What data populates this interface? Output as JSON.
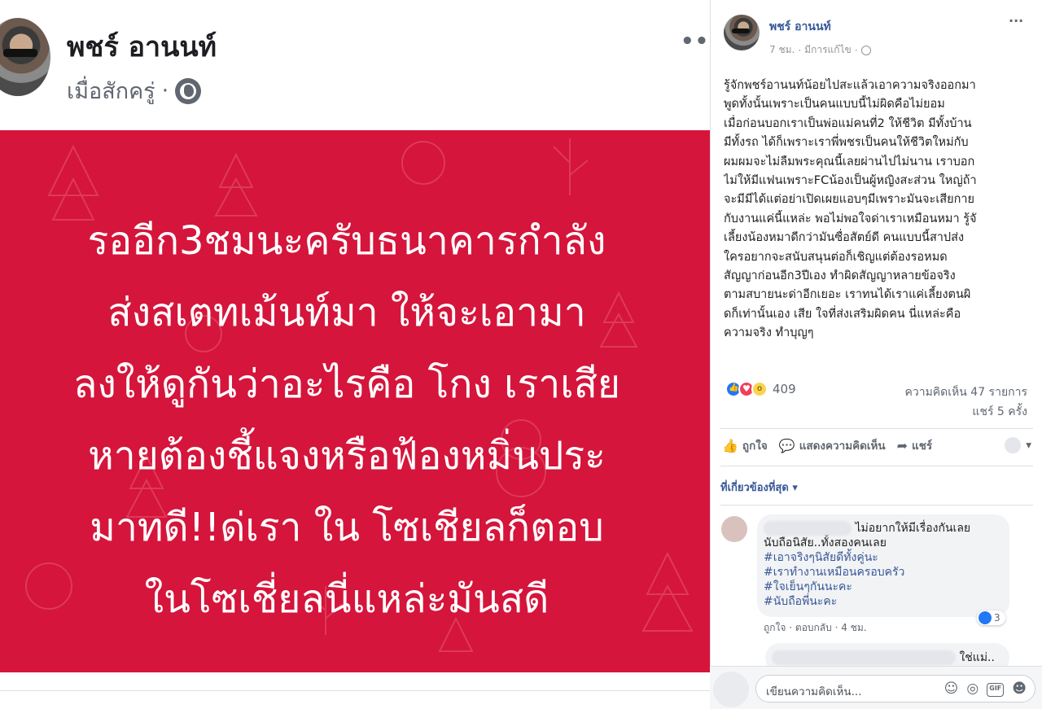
{
  "post": {
    "author": "พชร์ อานนท์",
    "time": "เมื่อสักครู่",
    "separator": "·",
    "more": "•••",
    "image_text": [
      "รออีก3ชมนะครับธนาคารกำลัง",
      "ส่งสเตทเม้นท์มา ให้จะเอามา",
      "ลงให้ดูกันว่าอะไรคือ โกง เราเสีย",
      "หายต้องชี้แจงหรือฟ้องหมิ่นประ",
      "มาทดี!!ด่เรา ใน โซเชียลก็ตอบ",
      "ในโซเชี่ยลนี่แหล่ะมันสดี"
    ],
    "image_bg_color": "#d5153b"
  },
  "side": {
    "author": "พชร์ อานนท์",
    "time": "7 ชม.",
    "edited": "มีการแก้ไข",
    "separator": "·",
    "more": "···",
    "caption": [
      "รู้จักพชร์อานนท์น้อยไปสะแล้วเอาความจริงออกมา",
      "พูดทั้งนั้นเพราะเป็นคนแบบนี้ไม่ผิดคือไม่ยอม",
      "เมื่อก่อนบอกเราเป็นพ่อแม่คนที่2 ให้ชีวิต มีทั้งบ้าน",
      "มีทั้งรถ ได้ก็เพราะเราพี่พชรเป็นคนให้ชีวิตใหม่กับ",
      "ผมผมจะไม่ลืมพระคุณนี้เลยผ่านไปไม่นาน เราบอก",
      "ไม่ให้มีแฟนเพราะFCน้องเป็นผู้หญิงสะส่วน ใหญ่ถ้า",
      "จะมีมีได้แต่อย่าเปิดเผยแอบๆมีเพราะมันจะเสียกาย",
      "กับงานแค่นี้แหล่ะ พอไม่พอใจด่าเราเหมือนหมา รู้จั",
      "เลี้ยงน้องหมาดีกว่ามันซื่อสัตย์ดี คนแบบนี้สาปส่ง",
      "ใครอยากจะสนับสนุนต่อก็เชิญแต่ต้องรอหมด",
      "สัญญาก่อนอีก3ปีเอง ทำผิดสัญญาหลายข้อจริง",
      "ตามสบายนะด่าอีกเยอะ เราทนได้เราแค่เลี้ยงตนผิ",
      "ดก็เท่านั้นเอง เสีย ใจที่ส่งเสริมผิดคน นี่แหล่ะคือ",
      "ความจริง ทำบุญๆ"
    ],
    "reaction_count": "409",
    "comments_count": "ความคิดเห็น 47 รายการ",
    "shares_count": "แชร์ 5 ครั้ง",
    "actions": {
      "like": "ถูกใจ",
      "comment": "แสดงความคิดเห็น",
      "share": "แชร์"
    },
    "sort_label": "ที่เกี่ยวข้องที่สุด ▾",
    "comments": [
      {
        "lines": [
          "ไม่อยากให้มีเรื่องกันเลย",
          "นับถือนิสัย..ทั้งสองคนเลย"
        ],
        "hashtags": [
          "#เอาจริงๆนิสัยดีทั้งคู่นะ",
          "#เราทำงานเหมือนครอบครัว",
          "#ใจเย็นๆกันนะคะ",
          "#นับถือพี่นะคะ"
        ],
        "like_label": "ถูกใจ",
        "reply_label": "ตอบกลับ",
        "time": "4 ชม.",
        "separator": "·",
        "likes": "3"
      },
      {
        "lines": [
          "ใช่แม่.."
        ]
      }
    ],
    "compose_placeholder": "เขียนความคิดเห็น...",
    "compose_icons": {
      "emoji": "☺",
      "camera": "◎",
      "gif": "GIF",
      "sticker": "☻"
    }
  }
}
